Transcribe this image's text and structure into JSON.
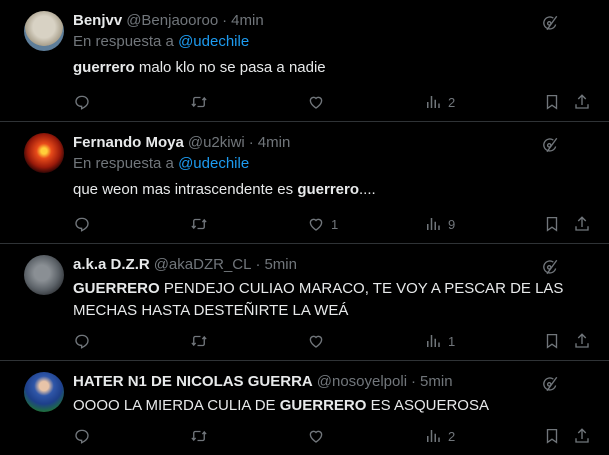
{
  "reply_prefix": "En respuesta a",
  "tweets": [
    {
      "name": "Benjvv",
      "handle": "@Benjaooroo",
      "time": "4min",
      "reply_to": "@udechile",
      "text_bold": "guerrero",
      "text_rest": " malo klo no se pasa a nadie",
      "replies": "",
      "retweets": "",
      "likes": "",
      "views": "2"
    },
    {
      "name": "Fernando Moya",
      "handle": "@u2kiwi",
      "time": "4min",
      "reply_to": "@udechile",
      "text_pre": "que weon mas intrascendente es ",
      "text_bold": "guerrero",
      "text_post": "....",
      "replies": "",
      "retweets": "",
      "likes": "1",
      "views": "9"
    },
    {
      "name": "a.k.a D.Z.R",
      "handle": "@akaDZR_CL",
      "time": "5min",
      "text_bold": "GUERRERO",
      "text_rest": " PENDEJO CULIAO MARACO, TE VOY A PESCAR DE LAS MECHAS HASTA DESTEÑIRTE LA WEÁ",
      "replies": "",
      "retweets": "",
      "likes": "",
      "views": "1"
    },
    {
      "name": "HATER N1 DE NICOLAS GUERRA",
      "handle": "@nosoyelpoli",
      "time": "5min",
      "text_pre": "OOOO LA MIERDA CULIA DE ",
      "text_bold": "GUERRERO",
      "text_post": " ES ASQUEROSA",
      "replies": "",
      "retweets": "",
      "likes": "",
      "views": "2"
    }
  ],
  "colors": {
    "background": "#000000",
    "text": "#e7e9ea",
    "muted": "#71767b",
    "link": "#1d9bf0",
    "divider": "#2f3336"
  },
  "icons": [
    "grok-icon",
    "reply-icon",
    "retweet-icon",
    "like-icon",
    "views-icon",
    "bookmark-icon",
    "share-icon"
  ]
}
